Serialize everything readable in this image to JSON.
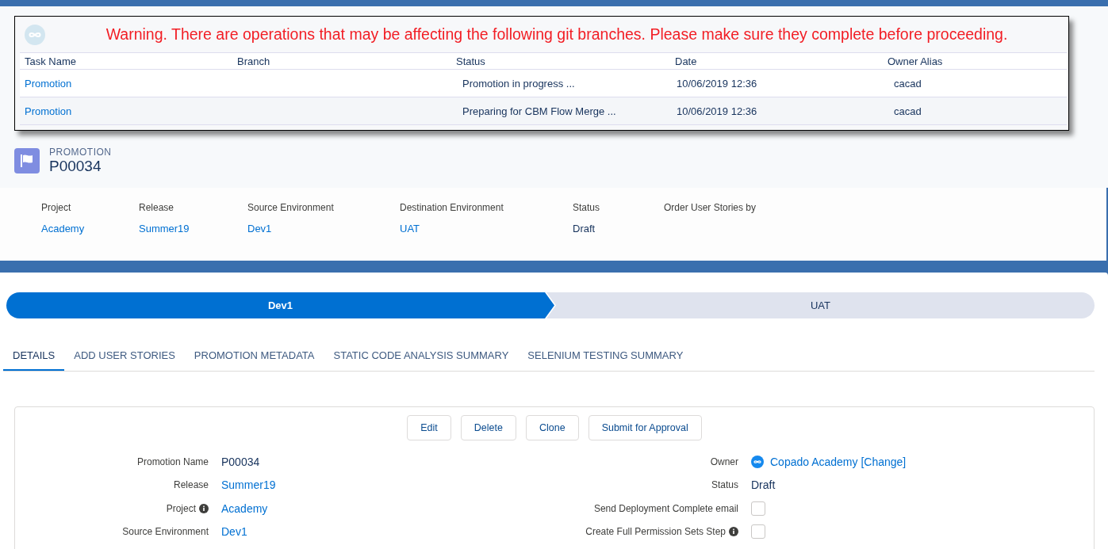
{
  "warning": {
    "message": "Warning. There are operations that may be affecting the following git branches. Please make sure they complete before proceeding.",
    "columns": [
      "Task Name",
      "Branch",
      "Status",
      "Date",
      "Owner Alias"
    ],
    "rows": [
      {
        "task": "Promotion",
        "status": "Promotion in progress ...",
        "date": "10/06/2019 12:36",
        "owner": "cacad"
      },
      {
        "task": "Promotion",
        "status": "Preparing for CBM Flow Merge ...",
        "date": "10/06/2019 12:36",
        "owner": "cacad"
      }
    ]
  },
  "record": {
    "type_label": "PROMOTION",
    "name": "P00034"
  },
  "highlights": [
    {
      "label": "Project",
      "value": "Academy",
      "kind": "link"
    },
    {
      "label": "Release",
      "value": "Summer19",
      "kind": "link"
    },
    {
      "label": "Source Environment",
      "value": "Dev1",
      "kind": "link"
    },
    {
      "label": "Destination Environment",
      "value": "UAT",
      "kind": "link"
    },
    {
      "label": "Status",
      "value": "Draft",
      "kind": "text"
    },
    {
      "label": "Order User Stories by"
    }
  ],
  "path": [
    {
      "label": "Dev1",
      "selected": true
    },
    {
      "label": "UAT",
      "selected": false
    }
  ],
  "tabs": [
    {
      "label": "DETAILS",
      "selected": true
    },
    {
      "label": "ADD USER STORIES",
      "selected": false
    },
    {
      "label": "PROMOTION METADATA",
      "selected": false
    },
    {
      "label": "STATIC CODE ANALYSIS SUMMARY",
      "selected": false
    },
    {
      "label": "SELENIUM TESTING SUMMARY",
      "selected": false
    }
  ],
  "buttons": [
    "Edit",
    "Delete",
    "Clone",
    "Submit for Approval"
  ],
  "fields": [
    {
      "left": {
        "label": "Promotion Name",
        "value": "P00034",
        "kind": "text",
        "info": false
      },
      "right": {
        "label": "Owner",
        "value": "Copado Academy [Change]",
        "kind": "user",
        "info": false
      }
    },
    {
      "left": {
        "label": "Release",
        "value": "Summer19",
        "kind": "link",
        "info": false
      },
      "right": {
        "label": "Status",
        "value": "Draft",
        "kind": "text",
        "info": false
      }
    },
    {
      "left": {
        "label": "Project",
        "value": "Academy",
        "kind": "link",
        "info": true
      },
      "right": {
        "label": "Send Deployment Complete email",
        "kind": "checkbox",
        "checked": false,
        "info": false
      }
    },
    {
      "left": {
        "label": "Source Environment",
        "value": "Dev1",
        "kind": "link",
        "info": false
      },
      "right": {
        "label": "Create Full Permission Sets Step",
        "kind": "checkbox",
        "checked": false,
        "info": true
      }
    }
  ]
}
